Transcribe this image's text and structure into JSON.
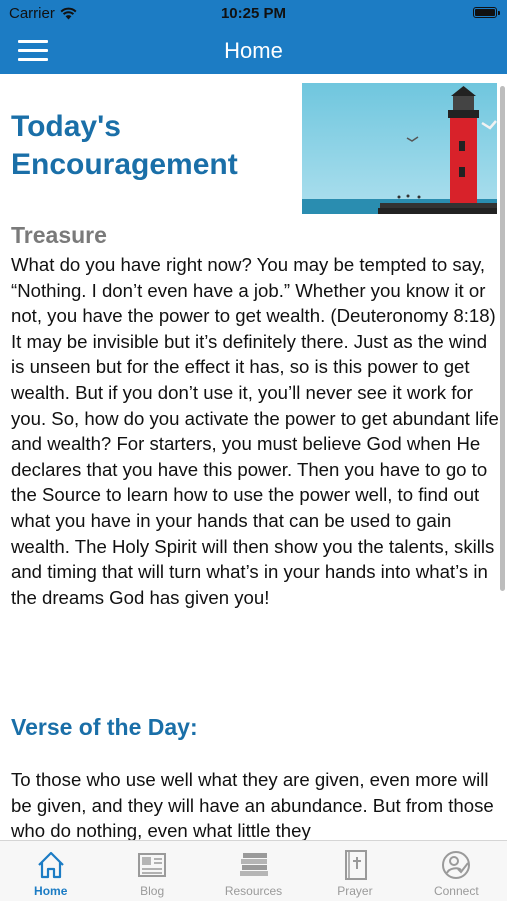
{
  "status_bar": {
    "carrier": "Carrier",
    "time": "10:25 PM"
  },
  "header": {
    "title": "Home"
  },
  "page": {
    "heading": "Today's Encouragement",
    "image_description": "lighthouse photo",
    "section_title": "Treasure",
    "body": "What do you have right now? You may be tempted to say, “Nothing. I don’t even have a job.” Whether you know it or not, you have the power to get wealth. (Deuteronomy 8:18) It may be invisible but it’s definitely there. Just as the wind is unseen but for the effect it has, so is this power to get wealth. But if you don’t use it, you’ll never see it work for you. So, how do you activate the power to get abundant life and wealth? For starters, you must believe God when He declares that you have this power. Then you have to go to the Source to learn how to use the power well, to find out what you have in your hands that can be used to gain wealth. The Holy Spirit will then show you the talents, skills and timing that will turn what’s in your hands into what’s in the dreams God has given you!",
    "verse_heading": "Verse of the Day:",
    "verse_text": "To those who use well what they are given, even more will be given, and they will have an abundance. But from those who do nothing, even what little they"
  },
  "tabs": [
    {
      "label": "Home",
      "icon": "home-icon",
      "active": true
    },
    {
      "label": "Blog",
      "icon": "blog-icon",
      "active": false
    },
    {
      "label": "Resources",
      "icon": "books-icon",
      "active": false
    },
    {
      "label": "Prayer",
      "icon": "bible-icon",
      "active": false
    },
    {
      "label": "Connect",
      "icon": "connect-icon",
      "active": false
    }
  ],
  "colors": {
    "primary": "#1c7cc4",
    "heading": "#1a6fa8",
    "inactive_tab": "#9a9a9a"
  }
}
